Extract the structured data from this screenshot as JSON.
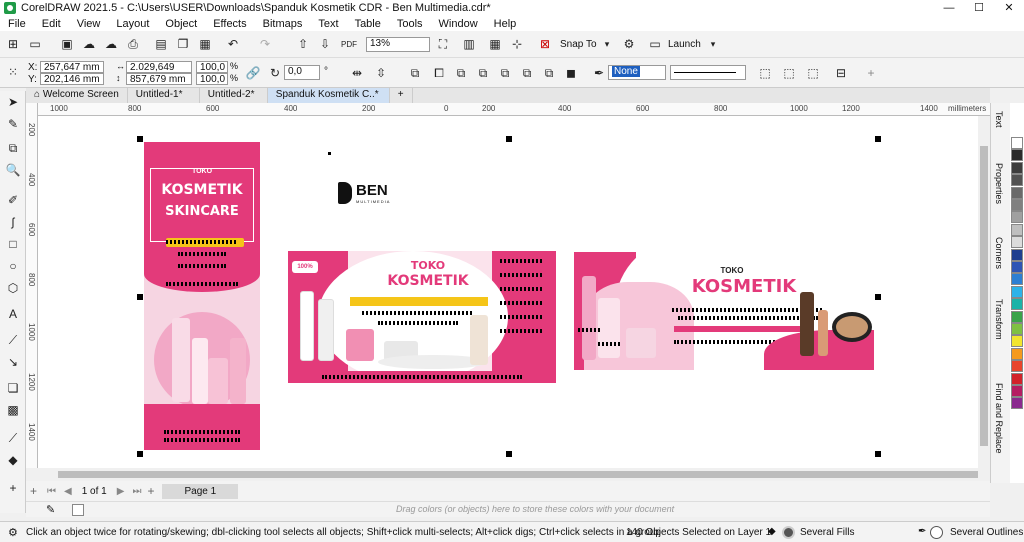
{
  "window": {
    "title": "CorelDRAW 2021.5 - C:\\Users\\USER\\Downloads\\Spanduk Kosmetik CDR - Ben Multimedia.cdr*",
    "minimize": "—",
    "maximize": "☐",
    "close": "✕"
  },
  "menu": [
    "File",
    "Edit",
    "View",
    "Layout",
    "Object",
    "Effects",
    "Bitmaps",
    "Text",
    "Table",
    "Tools",
    "Window",
    "Help"
  ],
  "toolbar": {
    "zoom": "13%",
    "snap_to": "Snap To",
    "launch": "Launch"
  },
  "propbar": {
    "x": "257,647 mm",
    "y": "202,146 mm",
    "x_label": "X:",
    "y_label": "Y:",
    "w": "2.029,649 mm",
    "h": "857,679 mm",
    "sx": "100,0",
    "sy": "100,0",
    "pct1": "%",
    "pct2": "%",
    "angle": "0,0",
    "angle_unit": "°",
    "outline": "None"
  },
  "tabs": [
    "Welcome Screen",
    "Untitled-1*",
    "Untitled-2*",
    "Spanduk Kosmetik C..*"
  ],
  "ruler": {
    "ticks_h": [
      "1000",
      "800",
      "600",
      "400",
      "200",
      "0",
      "200",
      "400",
      "600",
      "800",
      "1000",
      "1200",
      "1400"
    ],
    "unit": "millimeters",
    "ticks_v": [
      "200",
      "400",
      "600",
      "800",
      "1000",
      "1200",
      "1400"
    ]
  },
  "pagenav": {
    "page_of": "1 of 1",
    "page_tab": "Page 1"
  },
  "colorbar": {
    "hint": "Drag colors (or objects) here to store these colors with your document"
  },
  "status": {
    "hint": "Click an object twice for rotating/skewing; dbl-clicking tool selects all objects; Shift+click multi-selects; Alt+click digs; Ctrl+click selects in a group",
    "selection": "140 Objects Selected on Layer 1",
    "fills": "Several Fills",
    "outlines": "Several Outlines"
  },
  "dockers": [
    "Text",
    "Properties",
    "Corners",
    "Transform",
    "Find and Replace"
  ],
  "palette": [
    "#ffffff",
    "#2b2b2b",
    "#3d3d3d",
    "#525252",
    "#6a6a6a",
    "#808080",
    "#a0a0a0",
    "#bfbfbf",
    "#dcdcdc",
    "#1f3f8f",
    "#2f55b5",
    "#2d7fd3",
    "#2db2e8",
    "#1bb3a8",
    "#3aa34a",
    "#7fc043",
    "#f2e52f",
    "#f59a1f",
    "#e8452c",
    "#d2232a",
    "#b51e62",
    "#8a2a8e"
  ],
  "design": {
    "banner_v": {
      "toko": "TOKO",
      "line1": "KOSMETIK",
      "line2": "SKINCARE"
    },
    "banner_h1": {
      "toko": "TOKO",
      "kosmetik": "KOSMETIK",
      "badge": "100%"
    },
    "banner_h2": {
      "toko": "TOKO",
      "kosmetik": "KOSMETIK"
    },
    "logo": {
      "name": "BEN",
      "sub": "MULTIMEDIA"
    }
  },
  "colors": {
    "pink": "#e8307a",
    "deep_pink": "#d8266a",
    "light_pink": "#f7c6d9",
    "select": "#cfe0f4"
  }
}
